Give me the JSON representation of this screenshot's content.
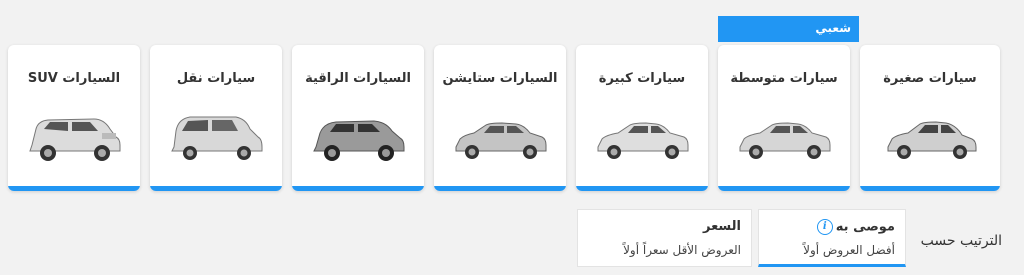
{
  "popular_badge": "شعبي",
  "categories": [
    {
      "label": "سيارات صغيرة",
      "icon": "small-car-icon"
    },
    {
      "label": "سيارات متوسطة",
      "icon": "medium-car-icon"
    },
    {
      "label": "سيارات كبيرة",
      "icon": "large-car-icon"
    },
    {
      "label": "السيارات ستايشن",
      "icon": "station-wagon-icon"
    },
    {
      "label": "السيارات الراقية",
      "icon": "premium-suv-icon"
    },
    {
      "label": "سيارات نقل",
      "icon": "van-icon"
    },
    {
      "label": "السيارات SUV",
      "icon": "suv-icon"
    }
  ],
  "sort": {
    "label": "الترتيب حسب",
    "options": [
      {
        "title": "موصى به",
        "subtitle": "أفضل العروض أولاً",
        "active": true
      },
      {
        "title": "السعر",
        "subtitle": "العروض الأقل سعراً أولاً",
        "active": false
      }
    ]
  },
  "colors": {
    "accent": "#2196f3",
    "background": "#f2f2f2",
    "card": "#ffffff"
  }
}
